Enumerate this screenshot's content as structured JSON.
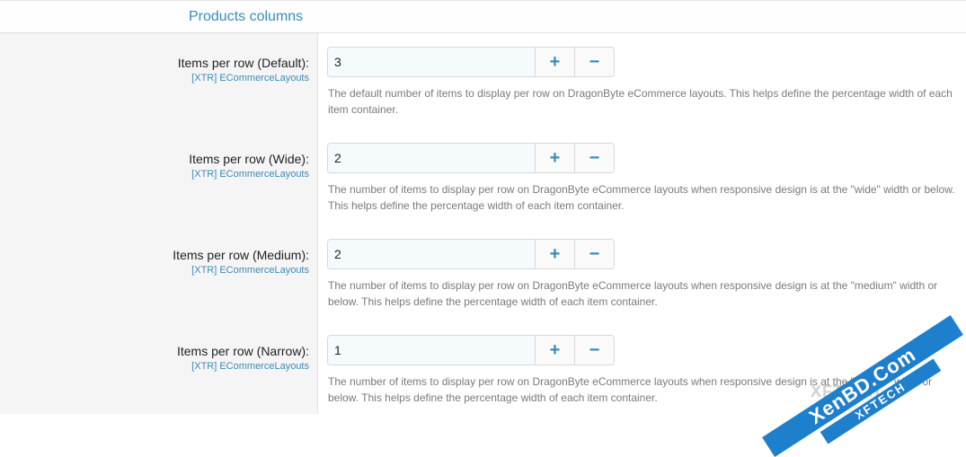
{
  "section": {
    "title": "Products columns"
  },
  "rows": [
    {
      "label": "Items per row (Default):",
      "addon": "[XTR] ECommerceLayouts",
      "value": "3",
      "description": "The default number of items to display per row on DragonByte eCommerce layouts. This helps define the percentage width of each item container."
    },
    {
      "label": "Items per row (Wide):",
      "addon": "[XTR] ECommerceLayouts",
      "value": "2",
      "description": "The number of items to display per row on DragonByte eCommerce layouts when responsive design is at the \"wide\" width or below. This helps define the percentage width of each item container."
    },
    {
      "label": "Items per row (Medium):",
      "addon": "[XTR] ECommerceLayouts",
      "value": "2",
      "description": "The number of items to display per row on DragonByte eCommerce layouts when responsive design is at the \"medium\" width or below. This helps define the percentage width of each item container."
    },
    {
      "label": "Items per row (Narrow):",
      "addon": "[XTR] ECommerceLayouts",
      "value": "1",
      "description": "The number of items to display per row on DragonByte eCommerce layouts when responsive design is at the \"narrow\" width or below. This helps define the percentage width of each item container."
    }
  ],
  "controls": {
    "plus_symbol": "+",
    "minus_symbol": "−"
  },
  "watermark": {
    "main": "XenBD.Com",
    "sub": "XFTECH",
    "ghost": "XFTECH"
  },
  "colors": {
    "accent": "#3a8bb8",
    "watermark": "#1e7fcd"
  }
}
